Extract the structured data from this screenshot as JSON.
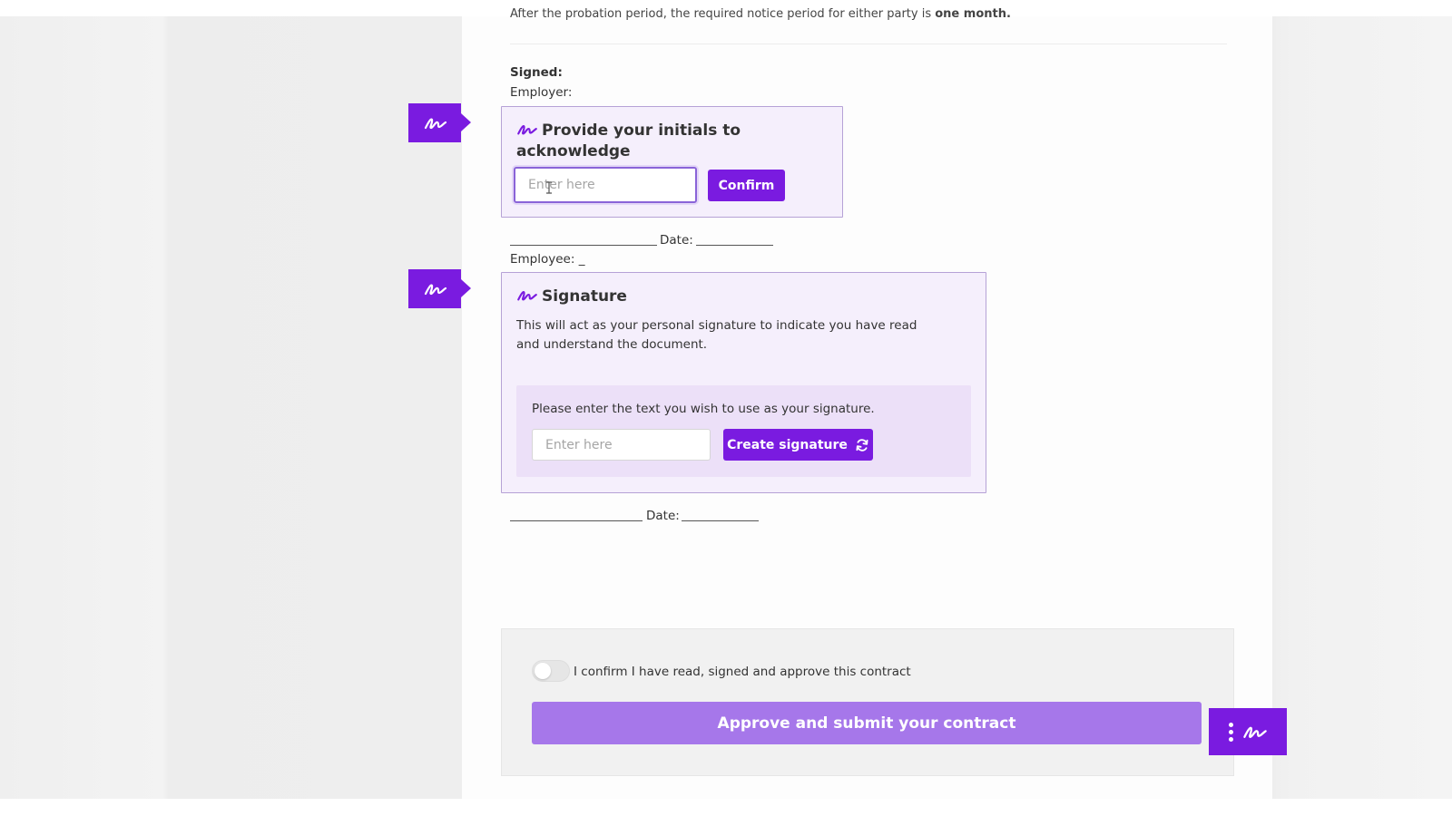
{
  "document": {
    "cutoff_text_prefix": "After the probation period, the required notice period for either party is ",
    "cutoff_text_bold": "one month.",
    "signed_label": "Signed:",
    "employer_label": "Employer:",
    "employee_label": "Employee: _",
    "date_label_1": "Date:",
    "date_label_2": "Date:"
  },
  "initials_card": {
    "title": "Provide your initials to acknowledge",
    "input_placeholder": "Enter here",
    "confirm_label": "Confirm"
  },
  "signature_card": {
    "title": "Signature",
    "description": "This will act as your personal signature to indicate you have read and understand the document.",
    "prompt": "Please enter the text you wish to use as your signature.",
    "input_placeholder": "Enter here",
    "create_label": "Create signature"
  },
  "footer": {
    "confirm_text": "I confirm I have read, signed and approve this contract",
    "toggle_on": false,
    "submit_label": "Approve and submit your contract"
  },
  "icons": {
    "flag": "signature-icon",
    "refresh": "refresh-icon",
    "menu": "vertical-dots-icon"
  },
  "colors": {
    "accent": "#7a1be0",
    "accent_light": "#a677ea",
    "card_bg": "#f5effc",
    "card_border": "#b6a2d6"
  }
}
